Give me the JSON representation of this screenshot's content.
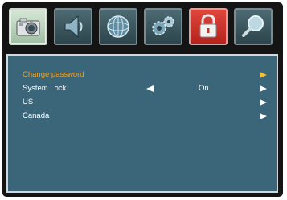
{
  "tabs": [
    {
      "icon": "camera-icon",
      "active": true
    },
    {
      "icon": "speaker-icon",
      "active": false
    },
    {
      "icon": "globe-icon",
      "active": false
    },
    {
      "icon": "gears-icon",
      "active": false
    },
    {
      "icon": "lock-icon",
      "active": false
    },
    {
      "icon": "magnifier-icon",
      "active": false
    }
  ],
  "menu": {
    "change_password": {
      "label": "Change password"
    },
    "system_lock": {
      "label": "System Lock",
      "value": "On"
    },
    "us": {
      "label": "US"
    },
    "canada": {
      "label": "Canada"
    }
  },
  "colors": {
    "panel_background": "#3b6579",
    "selected_text": "#f0a323",
    "selected_arrow": "#f2c12e",
    "text": "#ffffff"
  }
}
